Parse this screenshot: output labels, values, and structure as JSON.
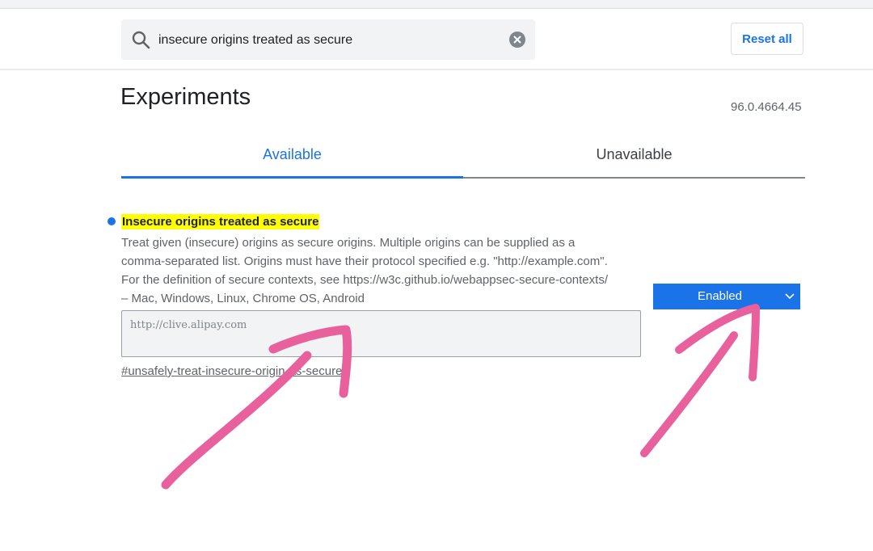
{
  "search": {
    "value": "insecure origins treated as secure",
    "icon": "search-icon",
    "clear_icon": "close-circle-icon"
  },
  "header": {
    "reset_label": "Reset all"
  },
  "page": {
    "title": "Experiments",
    "version": "96.0.4664.45"
  },
  "tabs": [
    {
      "label": "Available"
    },
    {
      "label": "Unavailable"
    }
  ],
  "experiment": {
    "title": "Insecure origins treated as secure",
    "description_lines": [
      "Treat given (insecure) origins as secure origins. Multiple origins can be supplied as a",
      "comma-separated list. Origins must have their protocol specified e.g. \"http://example.com\".",
      "For the definition of secure contexts, see https://w3c.github.io/webappsec-secure-contexts/",
      "– Mac, Windows, Linux, Chrome OS, Android"
    ],
    "origins_value": "http://clive.alipay.com",
    "link": "#unsafely-treat-insecure-origin-as-secure",
    "state": "Enabled"
  },
  "colors": {
    "accent": "#1a73e8",
    "highlight": "#ffff00",
    "annotation": "#e8609c"
  }
}
